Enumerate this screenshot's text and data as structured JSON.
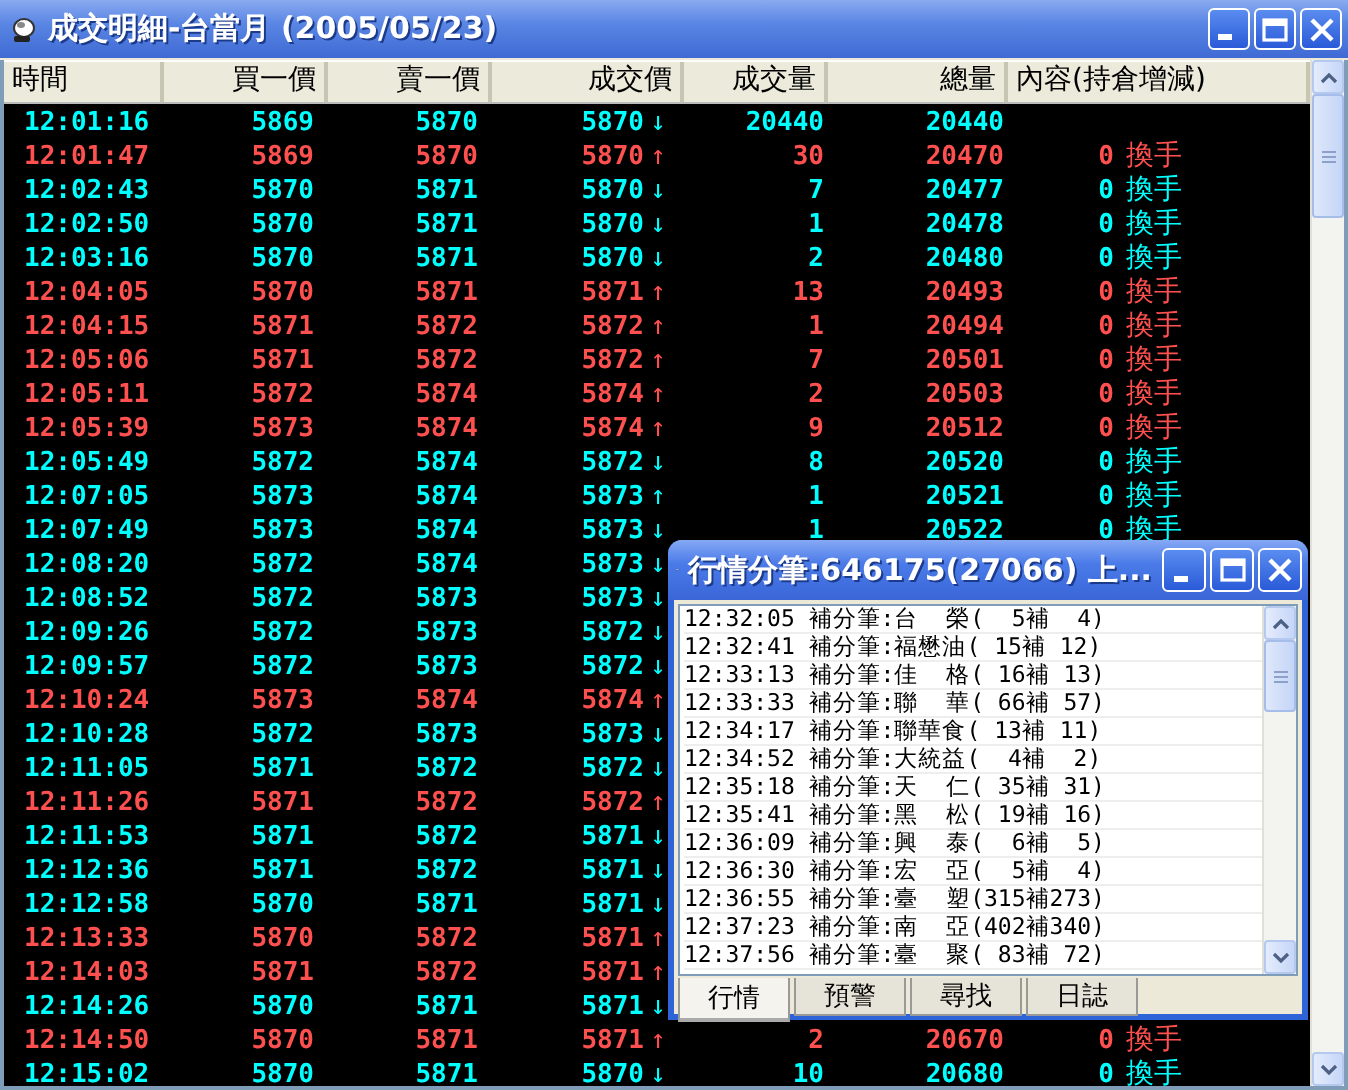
{
  "window": {
    "title": "成交明細-台當月 (2005/05/23)"
  },
  "table": {
    "columns": [
      "時間",
      "買一價",
      "賣一價",
      "成交價",
      "成交量",
      "總量",
      "內容(持倉增減)"
    ],
    "rows": [
      {
        "color": "#00ffff",
        "time": "12:01:16",
        "bid": "5869",
        "ask": "5870",
        "price": "5870",
        "arrow": "↓",
        "volume": "20440",
        "total": "20440"
      },
      {
        "color": "#ff5050",
        "time": "12:01:47",
        "bid": "5869",
        "ask": "5870",
        "price": "5870",
        "arrow": "↑",
        "volume": "30",
        "total": "20470",
        "change": "0",
        "content": "換手"
      },
      {
        "color": "#00ffff",
        "time": "12:02:43",
        "bid": "5870",
        "ask": "5871",
        "price": "5870",
        "arrow": "↓",
        "volume": "7",
        "total": "20477",
        "change": "0",
        "content": "換手"
      },
      {
        "color": "#00ffff",
        "time": "12:02:50",
        "bid": "5870",
        "ask": "5871",
        "price": "5870",
        "arrow": "↓",
        "volume": "1",
        "total": "20478",
        "change": "0",
        "content": "換手"
      },
      {
        "color": "#00ffff",
        "time": "12:03:16",
        "bid": "5870",
        "ask": "5871",
        "price": "5870",
        "arrow": "↓",
        "volume": "2",
        "total": "20480",
        "change": "0",
        "content": "換手"
      },
      {
        "color": "#ff5050",
        "time": "12:04:05",
        "bid": "5870",
        "ask": "5871",
        "price": "5871",
        "arrow": "↑",
        "volume": "13",
        "total": "20493",
        "change": "0",
        "content": "換手"
      },
      {
        "color": "#ff5050",
        "time": "12:04:15",
        "bid": "5871",
        "ask": "5872",
        "price": "5872",
        "arrow": "↑",
        "volume": "1",
        "total": "20494",
        "change": "0",
        "content": "換手"
      },
      {
        "color": "#ff5050",
        "time": "12:05:06",
        "bid": "5871",
        "ask": "5872",
        "price": "5872",
        "arrow": "↑",
        "volume": "7",
        "total": "20501",
        "change": "0",
        "content": "換手"
      },
      {
        "color": "#ff5050",
        "time": "12:05:11",
        "bid": "5872",
        "ask": "5874",
        "price": "5874",
        "arrow": "↑",
        "volume": "2",
        "total": "20503",
        "change": "0",
        "content": "換手"
      },
      {
        "color": "#ff5050",
        "time": "12:05:39",
        "bid": "5873",
        "ask": "5874",
        "price": "5874",
        "arrow": "↑",
        "volume": "9",
        "total": "20512",
        "change": "0",
        "content": "換手"
      },
      {
        "color": "#00ffff",
        "time": "12:05:49",
        "bid": "5872",
        "ask": "5874",
        "price": "5872",
        "arrow": "↓",
        "volume": "8",
        "total": "20520",
        "change": "0",
        "content": "換手"
      },
      {
        "color": "#00ffff",
        "time": "12:07:05",
        "bid": "5873",
        "ask": "5874",
        "price": "5873",
        "arrow": "↑",
        "volume": "1",
        "total": "20521",
        "change": "0",
        "content": "換手"
      },
      {
        "color": "#00ffff",
        "time": "12:07:49",
        "bid": "5873",
        "ask": "5874",
        "price": "5873",
        "arrow": "↓",
        "volume": "1",
        "total": "20522",
        "change": "0",
        "content": "換手"
      },
      {
        "color": "#00ffff",
        "time": "12:08:20",
        "bid": "5872",
        "ask": "5874",
        "price": "5873",
        "arrow": "↓"
      },
      {
        "color": "#00ffff",
        "time": "12:08:52",
        "bid": "5872",
        "ask": "5873",
        "price": "5873",
        "arrow": "↓"
      },
      {
        "color": "#00ffff",
        "time": "12:09:26",
        "bid": "5872",
        "ask": "5873",
        "price": "5872",
        "arrow": "↓"
      },
      {
        "color": "#00ffff",
        "time": "12:09:57",
        "bid": "5872",
        "ask": "5873",
        "price": "5872",
        "arrow": "↓"
      },
      {
        "color": "#ff5050",
        "time": "12:10:24",
        "bid": "5873",
        "ask": "5874",
        "price": "5874",
        "arrow": "↑"
      },
      {
        "color": "#00ffff",
        "time": "12:10:28",
        "bid": "5872",
        "ask": "5873",
        "price": "5873",
        "arrow": "↓"
      },
      {
        "color": "#00ffff",
        "time": "12:11:05",
        "bid": "5871",
        "ask": "5872",
        "price": "5872",
        "arrow": "↓"
      },
      {
        "color": "#ff5050",
        "time": "12:11:26",
        "bid": "5871",
        "ask": "5872",
        "price": "5872",
        "arrow": "↑"
      },
      {
        "color": "#00ffff",
        "time": "12:11:53",
        "bid": "5871",
        "ask": "5872",
        "price": "5871",
        "arrow": "↓"
      },
      {
        "color": "#00ffff",
        "time": "12:12:36",
        "bid": "5871",
        "ask": "5872",
        "price": "5871",
        "arrow": "↓"
      },
      {
        "color": "#00ffff",
        "time": "12:12:58",
        "bid": "5870",
        "ask": "5871",
        "price": "5871",
        "arrow": "↓"
      },
      {
        "color": "#ff5050",
        "time": "12:13:33",
        "bid": "5870",
        "ask": "5872",
        "price": "5871",
        "arrow": "↑"
      },
      {
        "color": "#ff5050",
        "time": "12:14:03",
        "bid": "5871",
        "ask": "5872",
        "price": "5871",
        "arrow": "↑"
      },
      {
        "color": "#00ffff",
        "time": "12:14:26",
        "bid": "5870",
        "ask": "5871",
        "price": "5871",
        "arrow": "↓"
      },
      {
        "color": "#ff5050",
        "time": "12:14:50",
        "bid": "5870",
        "ask": "5871",
        "price": "5871",
        "arrow": "↑",
        "volume": "2",
        "total": "20670",
        "change": "0",
        "content": "換手"
      },
      {
        "color": "#00ffff",
        "time": "12:15:02",
        "bid": "5870",
        "ask": "5871",
        "price": "5870",
        "arrow": "↓",
        "volume": "10",
        "total": "20680",
        "change": "0",
        "content": "換手"
      }
    ]
  },
  "popup": {
    "title": "行情分筆:646175(27066) 上...",
    "lines": [
      "12:32:05 補分筆:台  榮(  5補  4)",
      "12:32:41 補分筆:福懋油( 15補 12)",
      "12:33:13 補分筆:佳  格( 16補 13)",
      "12:33:33 補分筆:聯  華( 66補 57)",
      "12:34:17 補分筆:聯華食( 13補 11)",
      "12:34:52 補分筆:大統益(  4補  2)",
      "12:35:18 補分筆:天  仁( 35補 31)",
      "12:35:41 補分筆:黑  松( 19補 16)",
      "12:36:09 補分筆:興  泰(  6補  5)",
      "12:36:30 補分筆:宏  亞(  5補  4)",
      "12:36:55 補分筆:臺  塑(315補273)",
      "12:37:23 補分筆:南  亞(402補340)",
      "12:37:56 補分筆:臺  聚( 83補 72)"
    ],
    "tabs": [
      {
        "label": "行情",
        "selected": true
      },
      {
        "label": "預警",
        "selected": false
      },
      {
        "label": "尋找",
        "selected": false
      },
      {
        "label": "日誌",
        "selected": false
      }
    ]
  }
}
